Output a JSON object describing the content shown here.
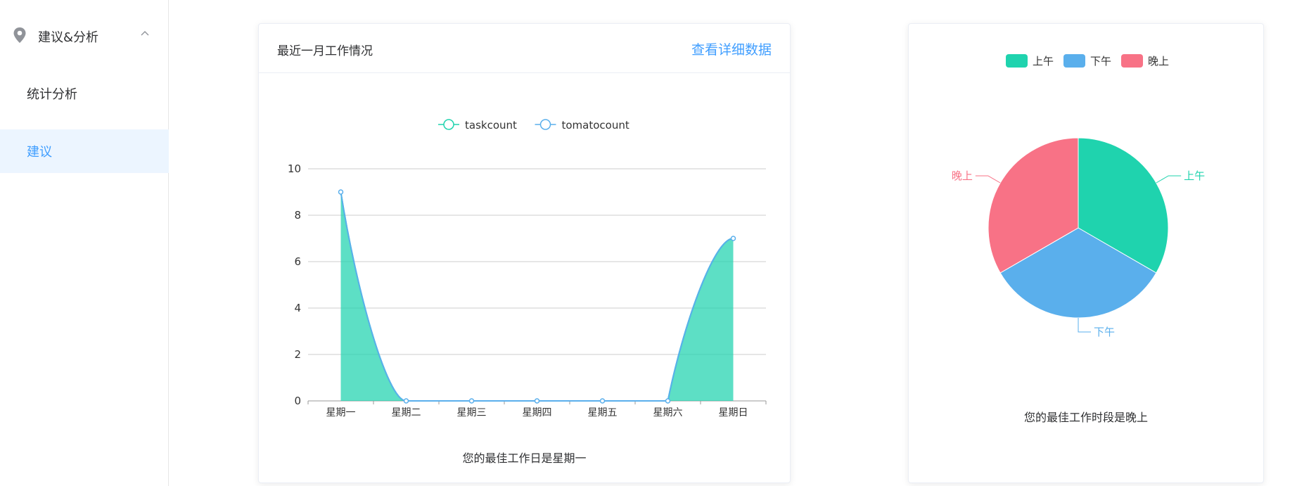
{
  "sidebar": {
    "group_label": "建议&分析",
    "icon": "location-pin-icon",
    "items": [
      {
        "label": "统计分析",
        "active": false
      },
      {
        "label": "建议",
        "active": true
      }
    ],
    "active_color": "#409eff"
  },
  "line_card": {
    "title": "最近一月工作情况",
    "link_label": "查看详细数据",
    "caption": "您的最佳工作日是星期一"
  },
  "pie_card": {
    "caption": "您的最佳工作时段是晚上"
  },
  "chart_data": [
    {
      "type": "area",
      "categories": [
        "星期一",
        "星期二",
        "星期三",
        "星期四",
        "星期五",
        "星期六",
        "星期日"
      ],
      "series": [
        {
          "name": "taskcount",
          "values": [
            9,
            0,
            0,
            0,
            0,
            0,
            7
          ],
          "color": "#1fd3ae"
        },
        {
          "name": "tomatocount",
          "values": [
            9,
            0,
            0,
            0,
            0,
            0,
            7
          ],
          "color": "#5aafec"
        }
      ],
      "ylim": [
        0,
        10
      ],
      "yticks": [
        0,
        2,
        4,
        6,
        8,
        10
      ],
      "grid": true,
      "legend": "top-center",
      "smooth": true
    },
    {
      "type": "pie",
      "labels": [
        "上午",
        "下午",
        "晚上"
      ],
      "values": [
        1,
        1,
        1
      ],
      "colors": [
        "#1fd3ae",
        "#5aafec",
        "#f87286"
      ],
      "legend": "top-center"
    }
  ]
}
